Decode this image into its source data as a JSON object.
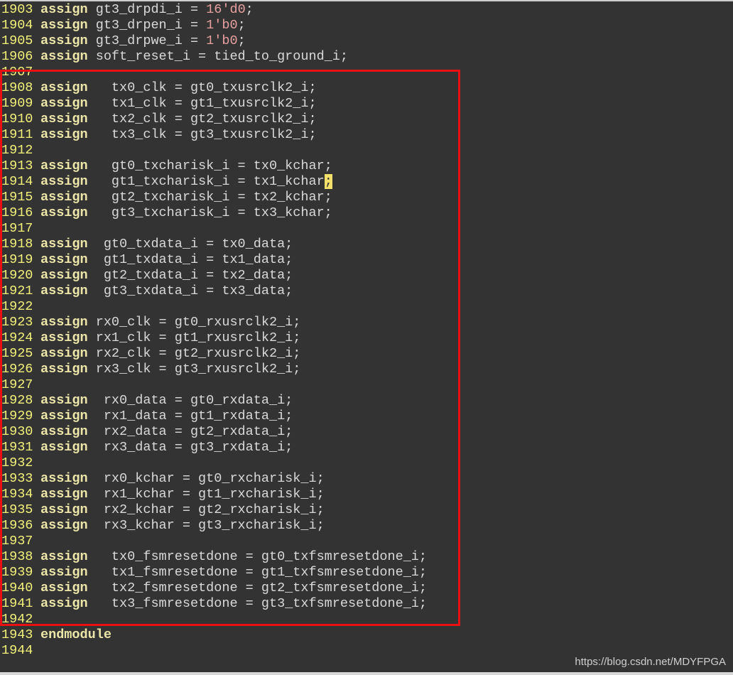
{
  "editor": {
    "lines": [
      {
        "num": "1903",
        "code": "assign gt3_drpdi_i = 16'd0;"
      },
      {
        "num": "1904",
        "code": "assign gt3_drpen_i = 1'b0;"
      },
      {
        "num": "1905",
        "code": "assign gt3_drpwe_i = 1'b0;"
      },
      {
        "num": "1906",
        "code": "assign soft_reset_i = tied_to_ground_i;"
      },
      {
        "num": "1907",
        "code": ""
      },
      {
        "num": "1908",
        "code": "assign   tx0_clk = gt0_txusrclk2_i;"
      },
      {
        "num": "1909",
        "code": "assign   tx1_clk = gt1_txusrclk2_i;"
      },
      {
        "num": "1910",
        "code": "assign   tx2_clk = gt2_txusrclk2_i;"
      },
      {
        "num": "1911",
        "code": "assign   tx3_clk = gt3_txusrclk2_i;"
      },
      {
        "num": "1912",
        "code": ""
      },
      {
        "num": "1913",
        "code": "assign   gt0_txcharisk_i = tx0_kchar;"
      },
      {
        "num": "1914",
        "code": "assign   gt1_txcharisk_i = tx1_kchar;",
        "cursor": true
      },
      {
        "num": "1915",
        "code": "assign   gt2_txcharisk_i = tx2_kchar;"
      },
      {
        "num": "1916",
        "code": "assign   gt3_txcharisk_i = tx3_kchar;"
      },
      {
        "num": "1917",
        "code": ""
      },
      {
        "num": "1918",
        "code": "assign  gt0_txdata_i = tx0_data;"
      },
      {
        "num": "1919",
        "code": "assign  gt1_txdata_i = tx1_data;"
      },
      {
        "num": "1920",
        "code": "assign  gt2_txdata_i = tx2_data;"
      },
      {
        "num": "1921",
        "code": "assign  gt3_txdata_i = tx3_data;"
      },
      {
        "num": "1922",
        "code": ""
      },
      {
        "num": "1923",
        "code": "assign rx0_clk = gt0_rxusrclk2_i;"
      },
      {
        "num": "1924",
        "code": "assign rx1_clk = gt1_rxusrclk2_i;"
      },
      {
        "num": "1925",
        "code": "assign rx2_clk = gt2_rxusrclk2_i;"
      },
      {
        "num": "1926",
        "code": "assign rx3_clk = gt3_rxusrclk2_i;"
      },
      {
        "num": "1927",
        "code": ""
      },
      {
        "num": "1928",
        "code": "assign  rx0_data = gt0_rxdata_i;"
      },
      {
        "num": "1929",
        "code": "assign  rx1_data = gt1_rxdata_i;"
      },
      {
        "num": "1930",
        "code": "assign  rx2_data = gt2_rxdata_i;"
      },
      {
        "num": "1931",
        "code": "assign  rx3_data = gt3_rxdata_i;"
      },
      {
        "num": "1932",
        "code": ""
      },
      {
        "num": "1933",
        "code": "assign  rx0_kchar = gt0_rxcharisk_i;"
      },
      {
        "num": "1934",
        "code": "assign  rx1_kchar = gt1_rxcharisk_i;"
      },
      {
        "num": "1935",
        "code": "assign  rx2_kchar = gt2_rxcharisk_i;"
      },
      {
        "num": "1936",
        "code": "assign  rx3_kchar = gt3_rxcharisk_i;"
      },
      {
        "num": "1937",
        "code": ""
      },
      {
        "num": "1938",
        "code": "assign   tx0_fsmresetdone = gt0_txfsmresetdone_i;"
      },
      {
        "num": "1939",
        "code": "assign   tx1_fsmresetdone = gt1_txfsmresetdone_i;"
      },
      {
        "num": "1940",
        "code": "assign   tx2_fsmresetdone = gt2_txfsmresetdone_i;"
      },
      {
        "num": "1941",
        "code": "assign   tx3_fsmresetdone = gt3_txfsmresetdone_i;"
      },
      {
        "num": "1942",
        "code": ""
      },
      {
        "num": "1943",
        "code": "endmodule"
      },
      {
        "num": "1944",
        "code": ""
      }
    ],
    "keywords": [
      "assign",
      "endmodule"
    ]
  },
  "colors": {
    "background": "#333333",
    "line_number": "#f2f27a",
    "keyword": "#ece6a8",
    "literal": "#e8a0a0",
    "highlight_box": "#e81010"
  },
  "watermark": "https://blog.csdn.net/MDYFPGA"
}
